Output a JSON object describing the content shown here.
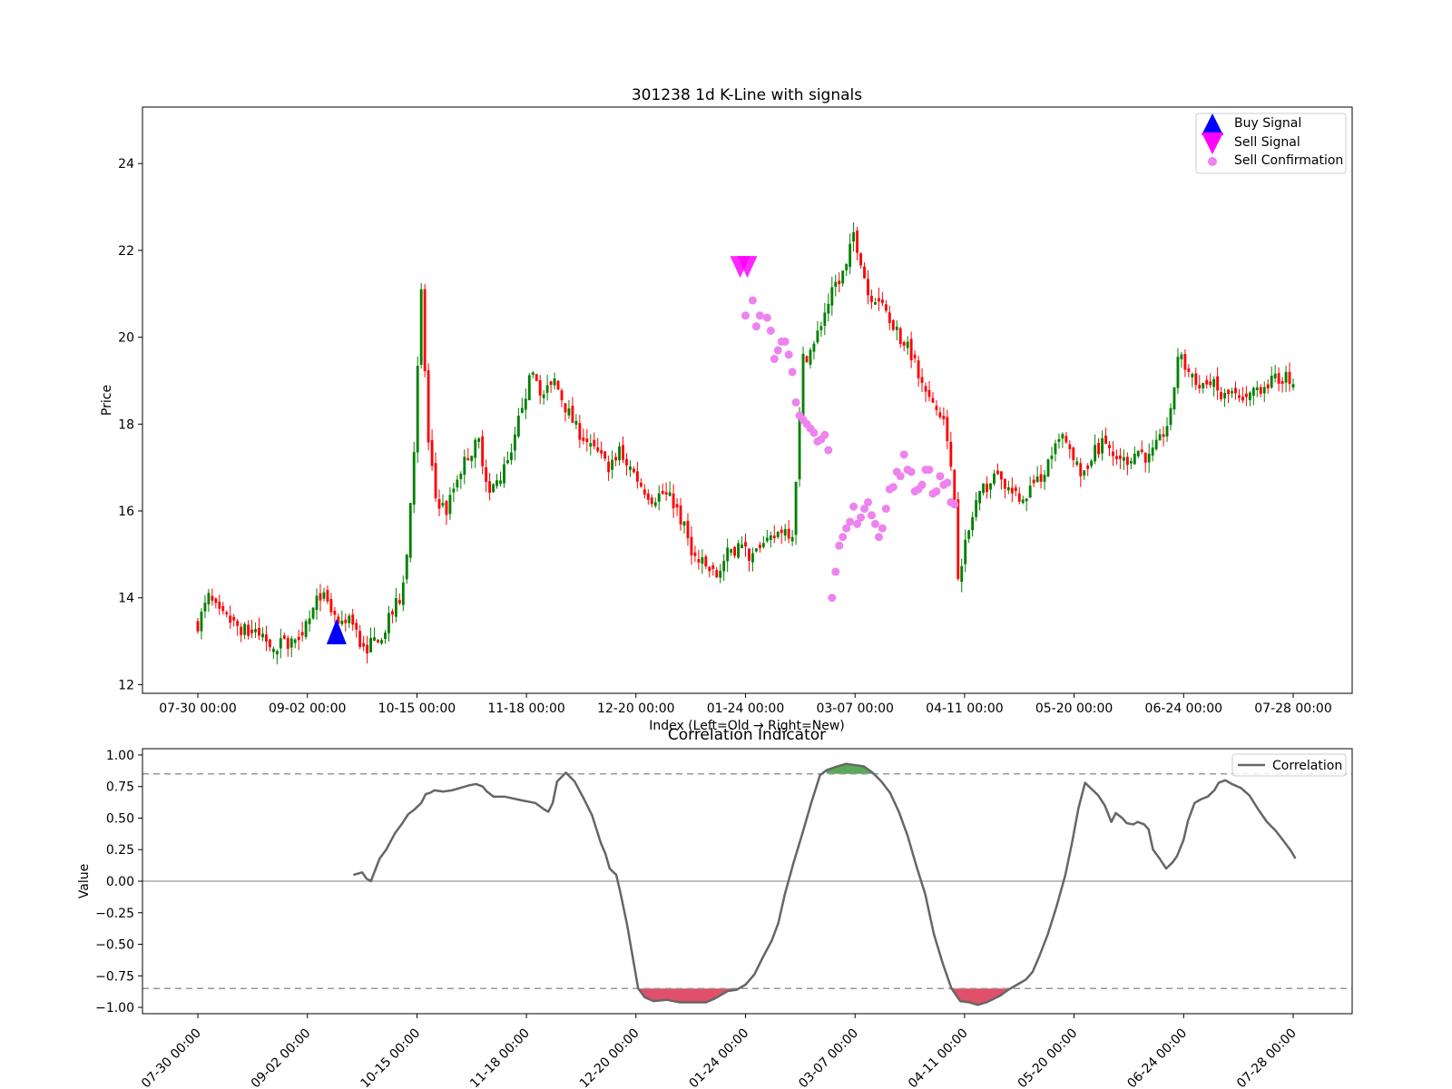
{
  "chart_data": [
    {
      "type": "candlestick",
      "title": "301238 1d K-Line with signals",
      "xlabel": "Index (Left=Old → Right=New)",
      "ylabel": "Price",
      "ylim": [
        11.8,
        25.3
      ],
      "yticks": [
        12,
        14,
        16,
        18,
        20,
        22,
        24
      ],
      "xlim": [
        -15.5,
        260.5
      ],
      "xtick_positions": [
        0,
        25,
        50,
        75,
        100,
        125,
        150,
        175,
        200,
        225,
        250
      ],
      "xtick_labels": [
        "07-30 00:00",
        "09-02 00:00",
        "10-15 00:00",
        "11-18 00:00",
        "12-20 00:00",
        "01-24 00:00",
        "03-07 00:00",
        "04-11 00:00",
        "05-20 00:00",
        "06-24 00:00",
        "07-28 00:00"
      ],
      "up_color": "#008000",
      "down_color": "#ff0000",
      "anchors": [
        [
          0,
          13.4
        ],
        [
          3,
          14.0
        ],
        [
          6,
          13.6
        ],
        [
          10,
          13.4
        ],
        [
          14,
          13.2
        ],
        [
          18,
          13.1
        ],
        [
          22,
          12.9
        ],
        [
          25,
          13.0
        ],
        [
          28,
          13.2
        ],
        [
          31,
          13.5
        ],
        [
          34,
          14.1
        ],
        [
          37,
          13.7
        ],
        [
          40,
          13.3
        ],
        [
          43,
          13.5
        ],
        [
          46,
          12.8
        ],
        [
          49,
          13.0
        ],
        [
          52,
          13.3
        ],
        [
          56,
          14.0
        ],
        [
          58,
          15.0
        ],
        [
          60,
          17.5
        ],
        [
          62,
          21.0
        ],
        [
          64,
          17.5
        ],
        [
          66,
          16.3
        ],
        [
          69,
          16.0
        ],
        [
          72,
          16.8
        ],
        [
          75,
          17.3
        ],
        [
          78,
          17.6
        ],
        [
          81,
          16.4
        ],
        [
          84,
          16.8
        ],
        [
          87,
          17.2
        ],
        [
          90,
          18.5
        ],
        [
          93,
          19.2
        ],
        [
          96,
          18.6
        ],
        [
          99,
          19.0
        ],
        [
          102,
          18.4
        ],
        [
          105,
          17.9
        ],
        [
          108,
          17.6
        ],
        [
          111,
          17.3
        ],
        [
          114,
          17.0
        ],
        [
          117,
          17.4
        ],
        [
          120,
          17.0
        ],
        [
          123,
          16.6
        ],
        [
          126,
          16.3
        ],
        [
          129,
          16.4
        ],
        [
          132,
          16.2
        ],
        [
          135,
          15.6
        ],
        [
          138,
          14.9
        ],
        [
          141,
          14.7
        ],
        [
          144,
          14.5
        ],
        [
          147,
          15.0
        ],
        [
          150,
          15.2
        ],
        [
          153,
          15.0
        ],
        [
          156,
          15.1
        ],
        [
          159,
          15.3
        ],
        [
          162,
          15.6
        ],
        [
          165,
          15.5
        ],
        [
          166,
          16.8
        ],
        [
          168,
          19.5
        ],
        [
          171,
          19.8
        ],
        [
          174,
          20.6
        ],
        [
          177,
          21.2
        ],
        [
          180,
          21.6
        ],
        [
          182,
          22.4
        ],
        [
          184,
          21.8
        ],
        [
          186,
          21.0
        ],
        [
          189,
          20.9
        ],
        [
          192,
          20.5
        ],
        [
          195,
          20.0
        ],
        [
          198,
          19.6
        ],
        [
          201,
          18.9
        ],
        [
          204,
          18.4
        ],
        [
          207,
          18.1
        ],
        [
          210,
          16.3
        ],
        [
          211,
          14.6
        ],
        [
          213,
          15.2
        ],
        [
          216,
          16.2
        ],
        [
          219,
          16.6
        ],
        [
          222,
          16.8
        ],
        [
          225,
          16.5
        ],
        [
          228,
          16.2
        ],
        [
          231,
          16.5
        ],
        [
          234,
          16.8
        ],
        [
          237,
          17.3
        ],
        [
          240,
          17.7
        ],
        [
          243,
          17.1
        ],
        [
          246,
          16.9
        ],
        [
          249,
          17.4
        ],
        [
          252,
          17.6
        ],
        [
          255,
          17.1
        ],
        [
          258,
          17.2
        ],
        [
          261,
          17.4
        ],
        [
          264,
          17.2
        ],
        [
          267,
          17.6
        ],
        [
          270,
          18.2
        ],
        [
          272,
          19.6
        ],
        [
          275,
          19.2
        ],
        [
          278,
          18.8
        ],
        [
          281,
          19.0
        ],
        [
          284,
          18.6
        ],
        [
          287,
          18.7
        ],
        [
          290,
          18.4
        ],
        [
          293,
          18.8
        ],
        [
          296,
          18.9
        ],
        [
          299,
          19.0
        ],
        [
          302,
          19.1
        ],
        [
          304,
          19.0
        ]
      ],
      "buy_signals": [
        {
          "x": 38.5,
          "y": 13.22
        }
      ],
      "sell_signals": [
        {
          "x": 150.5,
          "y": 21.62
        },
        {
          "x": 152.5,
          "y": 21.62
        }
      ],
      "sell_confirmations": [
        [
          152,
          20.5
        ],
        [
          154,
          20.85
        ],
        [
          155,
          20.25
        ],
        [
          156,
          20.5
        ],
        [
          158,
          20.45
        ],
        [
          159,
          20.15
        ],
        [
          160,
          19.5
        ],
        [
          161,
          19.7
        ],
        [
          162,
          19.9
        ],
        [
          163,
          19.9
        ],
        [
          164,
          19.6
        ],
        [
          165,
          19.2
        ],
        [
          166,
          18.5
        ],
        [
          167,
          18.2
        ],
        [
          168,
          18.1
        ],
        [
          169,
          18.0
        ],
        [
          170,
          17.9
        ],
        [
          171,
          17.8
        ],
        [
          172,
          17.6
        ],
        [
          173,
          17.65
        ],
        [
          174,
          17.75
        ],
        [
          175,
          17.4
        ],
        [
          176,
          14.0
        ],
        [
          177,
          14.6
        ],
        [
          178,
          15.2
        ],
        [
          179,
          15.4
        ],
        [
          180,
          15.6
        ],
        [
          181,
          15.75
        ],
        [
          182,
          16.1
        ],
        [
          183,
          15.7
        ],
        [
          184,
          15.85
        ],
        [
          185,
          16.05
        ],
        [
          186,
          16.2
        ],
        [
          187,
          15.9
        ],
        [
          188,
          15.7
        ],
        [
          189,
          15.4
        ],
        [
          190,
          15.6
        ],
        [
          191,
          16.05
        ],
        [
          192,
          16.5
        ],
        [
          193,
          16.55
        ],
        [
          194,
          16.9
        ],
        [
          195,
          16.8
        ],
        [
          196,
          17.3
        ],
        [
          197,
          16.95
        ],
        [
          198,
          16.9
        ],
        [
          199,
          16.45
        ],
        [
          200,
          16.5
        ],
        [
          201,
          16.6
        ],
        [
          202,
          16.95
        ],
        [
          203,
          16.95
        ],
        [
          204,
          16.4
        ],
        [
          205,
          16.45
        ],
        [
          206,
          16.8
        ],
        [
          207,
          16.6
        ],
        [
          208,
          16.65
        ],
        [
          209,
          16.2
        ],
        [
          210,
          16.15
        ]
      ],
      "legend": {
        "location": "top-right",
        "entries": [
          "Buy Signal",
          "Sell Signal",
          "Sell Confirmation"
        ]
      },
      "colors": {
        "buy": "#0000ff",
        "sell": "#ff00ff",
        "sell_confirmation": "#ee82ee"
      }
    },
    {
      "type": "line",
      "title": "Correlation Indicator",
      "xlabel": "",
      "ylabel": "Value",
      "ylim": [
        -1.05,
        1.05
      ],
      "yticks": [
        -1.0,
        -0.75,
        -0.5,
        -0.25,
        0.0,
        0.25,
        0.5,
        0.75,
        1.0
      ],
      "ytick_labels": [
        "−1.00",
        "−0.75",
        "−0.50",
        "−0.25",
        "0.00",
        "0.25",
        "0.50",
        "0.75",
        "1.00"
      ],
      "xtick_labels": [
        "07-30 00:00",
        "09-02 00:00",
        "10-15 00:00",
        "11-18 00:00",
        "12-20 00:00",
        "01-24 00:00",
        "03-07 00:00",
        "04-11 00:00",
        "05-20 00:00",
        "06-24 00:00",
        "07-28 00:00"
      ],
      "thresholds": [
        0.85,
        -0.85
      ],
      "series": [
        {
          "name": "Correlation",
          "color": "#666666",
          "points": [
            [
              35.5,
              0.05
            ],
            [
              37.5,
              0.07
            ],
            [
              38.5,
              0.02
            ],
            [
              39.5,
              0.0
            ],
            [
              41.5,
              0.18
            ],
            [
              43.0,
              0.25
            ],
            [
              45.0,
              0.38
            ],
            [
              46.5,
              0.45
            ],
            [
              48.0,
              0.53
            ],
            [
              49.5,
              0.57
            ],
            [
              51.0,
              0.62
            ],
            [
              52.0,
              0.69
            ],
            [
              53.0,
              0.7
            ],
            [
              54.0,
              0.72
            ],
            [
              56.0,
              0.71
            ],
            [
              58.0,
              0.72
            ],
            [
              60.0,
              0.74
            ],
            [
              62.0,
              0.76
            ],
            [
              63.5,
              0.77
            ],
            [
              65.0,
              0.75
            ],
            [
              66.0,
              0.71
            ],
            [
              67.5,
              0.67
            ],
            [
              70.0,
              0.67
            ],
            [
              74.0,
              0.64
            ],
            [
              77.0,
              0.62
            ],
            [
              79.0,
              0.57
            ],
            [
              80.0,
              0.55
            ],
            [
              81.0,
              0.62
            ],
            [
              82.0,
              0.79
            ],
            [
              84.0,
              0.86
            ],
            [
              86.0,
              0.79
            ],
            [
              88.0,
              0.66
            ],
            [
              90.0,
              0.52
            ],
            [
              92.0,
              0.3
            ],
            [
              93.0,
              0.22
            ],
            [
              94.0,
              0.1
            ],
            [
              95.5,
              0.05
            ],
            [
              96.5,
              -0.1
            ],
            [
              98.0,
              -0.35
            ],
            [
              99.5,
              -0.65
            ],
            [
              100.5,
              -0.85
            ],
            [
              102.0,
              -0.92
            ],
            [
              104.0,
              -0.95
            ],
            [
              107.0,
              -0.94
            ],
            [
              110.0,
              -0.96
            ],
            [
              113.0,
              -0.96
            ],
            [
              116.0,
              -0.96
            ],
            [
              118.0,
              -0.93
            ],
            [
              121.0,
              -0.87
            ],
            [
              123.0,
              -0.86
            ],
            [
              125.0,
              -0.82
            ],
            [
              127.0,
              -0.74
            ],
            [
              129.0,
              -0.6
            ],
            [
              131.0,
              -0.47
            ],
            [
              132.5,
              -0.33
            ],
            [
              134.0,
              -0.1
            ],
            [
              136.0,
              0.15
            ],
            [
              138.0,
              0.38
            ],
            [
              140.0,
              0.62
            ],
            [
              142.0,
              0.84
            ],
            [
              143.5,
              0.88
            ],
            [
              146.0,
              0.91
            ],
            [
              148.0,
              0.93
            ],
            [
              150.0,
              0.92
            ],
            [
              152.0,
              0.91
            ],
            [
              154.0,
              0.86
            ],
            [
              156.0,
              0.79
            ],
            [
              158.0,
              0.7
            ],
            [
              160.0,
              0.55
            ],
            [
              162.0,
              0.36
            ],
            [
              164.0,
              0.12
            ],
            [
              166.0,
              -0.1
            ],
            [
              168.0,
              -0.42
            ],
            [
              170.0,
              -0.65
            ],
            [
              172.0,
              -0.85
            ],
            [
              174.0,
              -0.95
            ],
            [
              176.0,
              -0.96
            ],
            [
              178.0,
              -0.98
            ],
            [
              180.0,
              -0.96
            ],
            [
              183.0,
              -0.91
            ],
            [
              185.0,
              -0.86
            ],
            [
              187.0,
              -0.82
            ],
            [
              189.0,
              -0.78
            ],
            [
              190.5,
              -0.72
            ],
            [
              192.0,
              -0.6
            ],
            [
              194.0,
              -0.42
            ],
            [
              196.0,
              -0.2
            ],
            [
              198.0,
              0.05
            ],
            [
              199.5,
              0.3
            ],
            [
              201.0,
              0.58
            ],
            [
              202.5,
              0.78
            ],
            [
              204.0,
              0.73
            ],
            [
              205.5,
              0.68
            ],
            [
              207.0,
              0.6
            ],
            [
              208.5,
              0.47
            ],
            [
              209.5,
              0.54
            ],
            [
              211.0,
              0.5
            ],
            [
              212.0,
              0.46
            ],
            [
              213.5,
              0.45
            ],
            [
              214.5,
              0.47
            ],
            [
              216.0,
              0.45
            ],
            [
              217.0,
              0.41
            ],
            [
              218.0,
              0.25
            ],
            [
              219.5,
              0.18
            ],
            [
              221.0,
              0.1
            ],
            [
              222.5,
              0.15
            ],
            [
              223.5,
              0.2
            ],
            [
              225.0,
              0.33
            ],
            [
              226.0,
              0.48
            ],
            [
              227.5,
              0.62
            ],
            [
              229.0,
              0.65
            ],
            [
              230.5,
              0.67
            ],
            [
              232.0,
              0.72
            ],
            [
              233.0,
              0.78
            ],
            [
              234.5,
              0.8
            ],
            [
              236.0,
              0.77
            ],
            [
              238.0,
              0.74
            ],
            [
              240.0,
              0.68
            ],
            [
              242.0,
              0.57
            ],
            [
              244.0,
              0.47
            ],
            [
              246.0,
              0.4
            ],
            [
              248.0,
              0.31
            ],
            [
              249.5,
              0.24
            ],
            [
              250.5,
              0.18
            ]
          ]
        }
      ],
      "fill_colors": {
        "above_upper": "#5aa95a",
        "below_lower": "#e0506a"
      },
      "legend": {
        "location": "top-right",
        "entries": [
          "Correlation"
        ]
      }
    }
  ]
}
